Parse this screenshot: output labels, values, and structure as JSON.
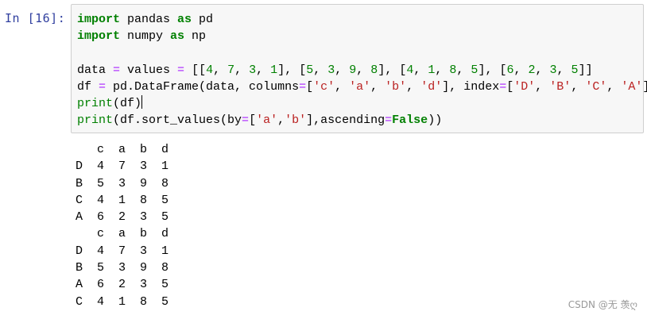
{
  "cell": {
    "prompt": "In  [16]:",
    "code_lines": [
      "import pandas as pd",
      "import numpy as np",
      "",
      "data = values = [[4, 7, 3, 1], [5, 3, 9, 8], [4, 1, 8, 5], [6, 2, 3, 5]]",
      "df = pd.DataFrame(data, columns=['c', 'a', 'b', 'd'], index=['D', 'B', 'C', 'A'])",
      "print(df)",
      "print(df.sort_values(by=['a','b'],ascending=False))"
    ]
  },
  "output": {
    "lines": [
      "   c  a  b  d",
      "D  4  7  3  1",
      "B  5  3  9  8",
      "C  4  1  8  5",
      "A  6  2  3  5",
      "   c  a  b  d",
      "D  4  7  3  1",
      "B  5  3  9  8",
      "A  6  2  3  5",
      "C  4  1  8  5"
    ]
  },
  "watermark": "CSDN @无 羡ღ"
}
